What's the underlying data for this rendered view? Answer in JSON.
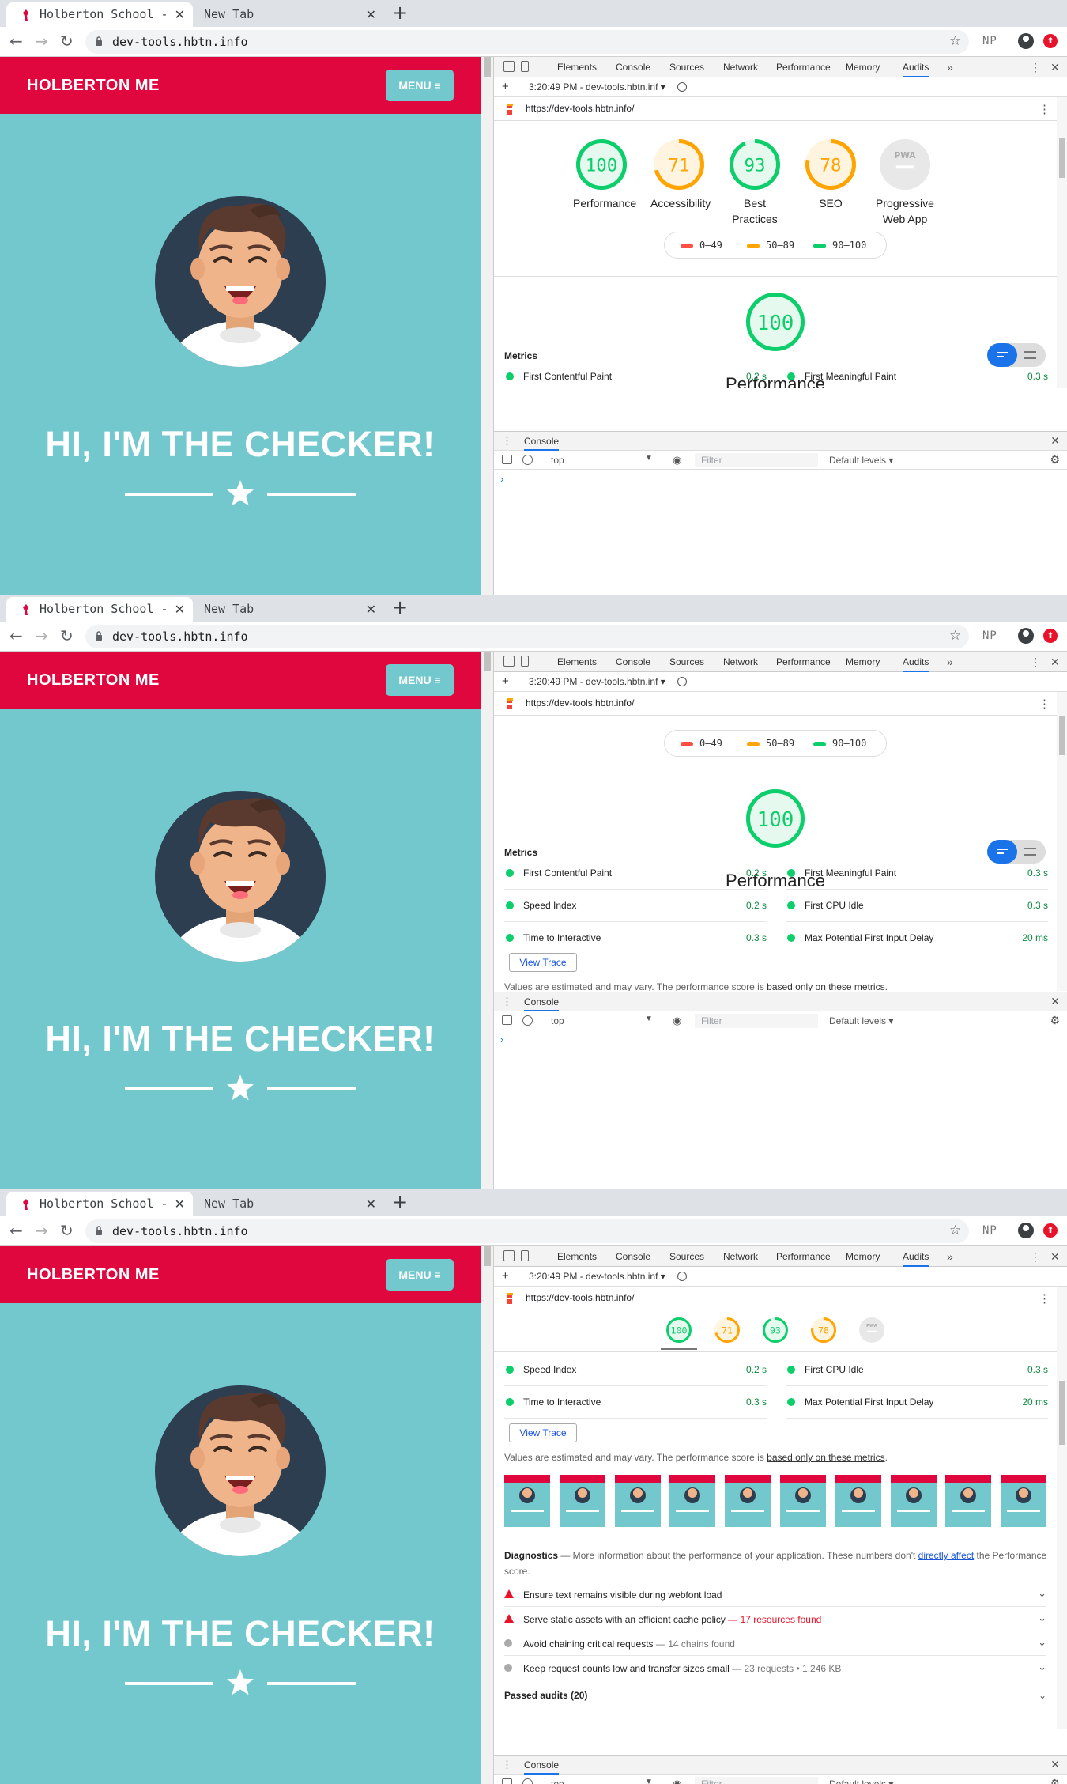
{
  "browser": {
    "tab_active_title": "Holberton School - ķ",
    "tab_new_title": "New Tab",
    "url": "dev-tools.hbtn.info",
    "profile_initials": "NP"
  },
  "site": {
    "brand": "HOLBERTON ME",
    "menu_label": "MENU ≡",
    "hero_title": "HI, I'M THE CHECKER!",
    "colors": {
      "header": "#e0073f",
      "background": "#73c8cd"
    }
  },
  "devtools": {
    "tabs": [
      "Elements",
      "Console",
      "Sources",
      "Network",
      "Performance",
      "Memory",
      "Audits"
    ],
    "selected_tab": "Audits",
    "more": "»",
    "report_selector": "3:20:49 PM - dev-tools.hbtn.inf ▾",
    "report_url": "https://dev-tools.hbtn.info/",
    "scores": [
      {
        "label": "Performance",
        "value": "100",
        "color": "#0cce6b",
        "fill": 1.0
      },
      {
        "label": "Accessibility",
        "value": "71",
        "color": "#ffa400",
        "fill": 0.71
      },
      {
        "label": "Best Practices",
        "value": "93",
        "color": "#0cce6b",
        "fill": 0.93
      },
      {
        "label": "SEO",
        "value": "78",
        "color": "#ffa400",
        "fill": 0.78
      },
      {
        "label": "Progressive Web App",
        "value": "",
        "color": "#cccccc",
        "fill": 0
      }
    ],
    "pwa_badge": "PWA",
    "legend": [
      {
        "range": "0–49",
        "color": "#ff4e42"
      },
      {
        "range": "50–89",
        "color": "#ffa400"
      },
      {
        "range": "90–100",
        "color": "#0cce6b"
      }
    ],
    "performance_title": "Performance",
    "performance_score": "100",
    "metrics_heading": "Metrics",
    "metrics": [
      {
        "name": "First Contentful Paint",
        "value": "0.2 s"
      },
      {
        "name": "First Meaningful Paint",
        "value": "0.3 s"
      },
      {
        "name": "Speed Index",
        "value": "0.2 s"
      },
      {
        "name": "First CPU Idle",
        "value": "0.3 s"
      },
      {
        "name": "Time to Interactive",
        "value": "0.3 s"
      },
      {
        "name": "Max Potential First Input Delay",
        "value": "20 ms"
      }
    ],
    "view_trace": "View Trace",
    "note_prefix": "Values are estimated and may vary. The performance score is ",
    "note_link": "based only on these metrics",
    "note_suffix": ".",
    "diagnostics_heading": "Diagnostics",
    "diagnostics_text": " — More information about the performance of your application. These numbers don't ",
    "diagnostics_link": "directly affect",
    "diagnostics_suffix": " the Performance score.",
    "diagnostics": [
      {
        "text": "Ensure text remains visible during webfont load",
        "detail": "",
        "severity": "fail"
      },
      {
        "text": "Serve static assets with an efficient cache policy",
        "detail": " — 17 resources found",
        "severity": "fail"
      },
      {
        "text": "Avoid chaining critical requests",
        "detail": " — 14 chains found",
        "severity": "info"
      },
      {
        "text": "Keep request counts low and transfer sizes small",
        "detail": " — 23 requests • 1,246 KB",
        "severity": "info"
      }
    ],
    "passed_audits": "Passed audits (20)",
    "console": {
      "tab": "Console",
      "context": "top",
      "filter_placeholder": "Filter",
      "levels": "Default levels ▾",
      "prompt": "›"
    }
  }
}
